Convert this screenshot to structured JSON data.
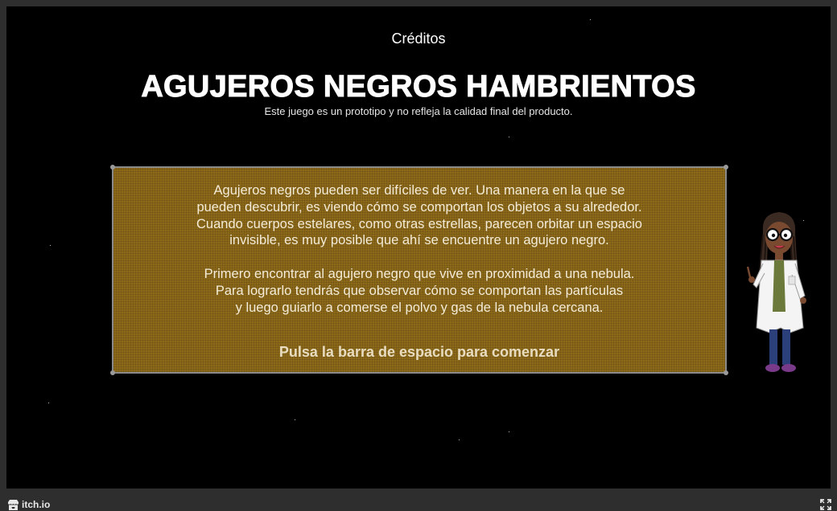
{
  "game": {
    "credits_label": "Créditos",
    "title": "AGUJEROS NEGROS HAMBRIENTOS",
    "subtitle": "Este juego es un prototipo y no refleja la calidad final del producto.",
    "panel": {
      "paragraph1": [
        "Agujeros negros pueden ser difíciles de ver. Una manera en la que se",
        "pueden descubrir, es viendo cómo se comportan los objetos a su alrededor.",
        "Cuando cuerpos estelares, como otras estrellas, parecen orbitar un espacio",
        "invisible, es muy posible que ahí se encuentre un agujero negro."
      ],
      "paragraph2": [
        "Primero encontrar al agujero negro que vive en proximidad a una nebula.",
        "Para lograrlo tendrás que observar cómo se comportan las partículas",
        "y luego guiarlo a comerse el polvo y gas de la nebula cercana."
      ],
      "start_prompt": "Pulsa la barra de espacio para comenzar"
    },
    "colors": {
      "background": "#000000",
      "panel": "#8d6a1a",
      "panel_text": "#f4ecd8"
    }
  },
  "footer": {
    "brand_label": "itch.io",
    "brand_icon": "itch-icon",
    "fullscreen_icon": "fullscreen-icon"
  }
}
